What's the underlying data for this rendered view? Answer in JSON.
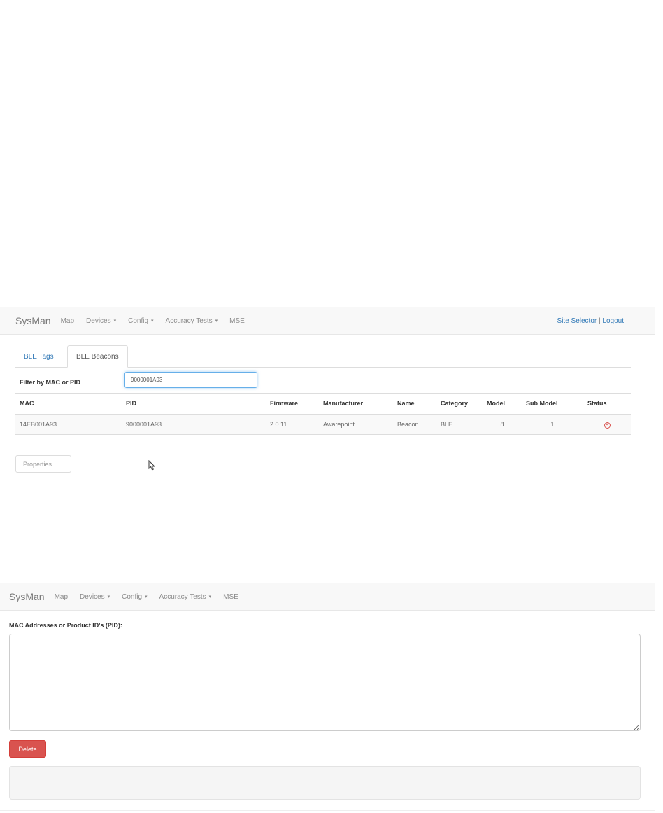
{
  "panel1": {
    "navbar": {
      "brand": "SysMan",
      "items": [
        {
          "label": "Map",
          "dropdown": false
        },
        {
          "label": "Devices",
          "dropdown": true
        },
        {
          "label": "Config",
          "dropdown": true
        },
        {
          "label": "Accuracy Tests",
          "dropdown": true
        },
        {
          "label": "MSE",
          "dropdown": false
        }
      ],
      "site_selector": "Site Selector",
      "separator": "|",
      "logout": "Logout"
    },
    "tabs": [
      "BLE Tags",
      "BLE Beacons"
    ],
    "active_tab": "BLE Beacons",
    "filter": {
      "label": "Filter by MAC or PID",
      "value": "9000001A93"
    },
    "table": {
      "columns": [
        "MAC",
        "PID",
        "Firmware",
        "Manufacturer",
        "Name",
        "Category",
        "Model",
        "Sub Model",
        "Status"
      ],
      "rows": [
        {
          "mac": "14EB001A93",
          "pid": "9000001A93",
          "firmware": "2.0.11",
          "manufacturer": "Awarepoint",
          "name": "Beacon",
          "category": "BLE",
          "model": "8",
          "sub_model": "1",
          "status_icon": "circle-x-icon"
        }
      ]
    },
    "properties_button": "Properties..."
  },
  "panel2": {
    "navbar": {
      "brand": "SysMan",
      "items": [
        {
          "label": "Map",
          "dropdown": false
        },
        {
          "label": "Devices",
          "dropdown": true
        },
        {
          "label": "Config",
          "dropdown": true
        },
        {
          "label": "Accuracy Tests",
          "dropdown": true
        },
        {
          "label": "MSE",
          "dropdown": false
        }
      ]
    },
    "mac_label": "MAC Addresses or Product ID's (PID):",
    "textarea_value": "",
    "delete_button": "Delete"
  },
  "colors": {
    "link": "#337ab7",
    "danger": "#d9534f",
    "navbar_bg": "#f8f8f8"
  },
  "caret_glyph": "▾"
}
